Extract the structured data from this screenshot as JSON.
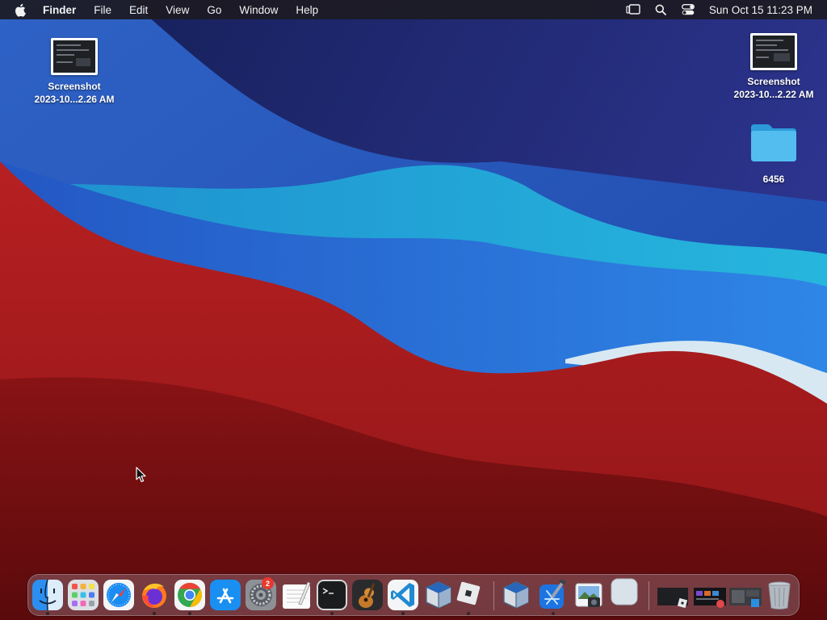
{
  "menubar": {
    "app_name": "Finder",
    "menus": [
      "File",
      "Edit",
      "View",
      "Go",
      "Window",
      "Help"
    ],
    "clock": "Sun Oct 15  11:23 PM"
  },
  "desktop": {
    "icons": [
      {
        "label_line1": "Screenshot",
        "label_line2": "2023-10...2.26 AM",
        "kind": "screenshot"
      },
      {
        "label_line1": "Screenshot",
        "label_line2": "2023-10...2.22 AM",
        "kind": "screenshot"
      },
      {
        "label": "6456",
        "kind": "folder"
      }
    ]
  },
  "dock": {
    "apps": [
      {
        "name": "Finder",
        "icon": "finder-icon",
        "running": true
      },
      {
        "name": "Launchpad",
        "icon": "launchpad-icon",
        "running": false
      },
      {
        "name": "Safari",
        "icon": "safari-icon",
        "running": false
      },
      {
        "name": "Firefox",
        "icon": "firefox-icon",
        "running": true
      },
      {
        "name": "Chrome",
        "icon": "chrome-icon",
        "running": true
      },
      {
        "name": "App Store",
        "icon": "app-store-icon",
        "running": false
      },
      {
        "name": "System Settings",
        "icon": "settings-icon",
        "running": false,
        "badge": "2"
      },
      {
        "name": "TextEdit",
        "icon": "textedit-icon",
        "running": false
      },
      {
        "name": "Terminal",
        "icon": "terminal-icon",
        "running": true
      },
      {
        "name": "Instruments",
        "icon": "instruments-icon",
        "running": false
      },
      {
        "name": "Visual Studio Code",
        "icon": "vscode-icon",
        "running": true
      },
      {
        "name": "VirtualBox",
        "icon": "virtualbox-icon",
        "running": false
      },
      {
        "name": "Roblox",
        "icon": "roblox-icon",
        "running": true
      },
      {
        "name": "VirtualBox VM",
        "icon": "virtualbox-vm-icon",
        "running": false
      },
      {
        "name": "Xcode",
        "icon": "xcode-icon",
        "running": true
      },
      {
        "name": "Preview",
        "icon": "preview-icon",
        "running": false
      },
      {
        "name": "Blank App",
        "icon": "blank-app-icon",
        "running": false
      },
      {
        "name": "Recent Window 1",
        "icon": "window-thumbnail-icon",
        "running": false
      },
      {
        "name": "Recent Window 2",
        "icon": "window-thumbnail-icon",
        "running": false
      },
      {
        "name": "Recent Window 3",
        "icon": "window-thumbnail-icon",
        "running": false
      },
      {
        "name": "Trash",
        "icon": "trash-icon",
        "running": false
      }
    ]
  },
  "colors": {
    "navy": "#1e2a6b",
    "blue": "#2a6fd4",
    "cyan": "#22a8d6",
    "red": "#b81e1e",
    "dark_red": "#6e0e10"
  }
}
